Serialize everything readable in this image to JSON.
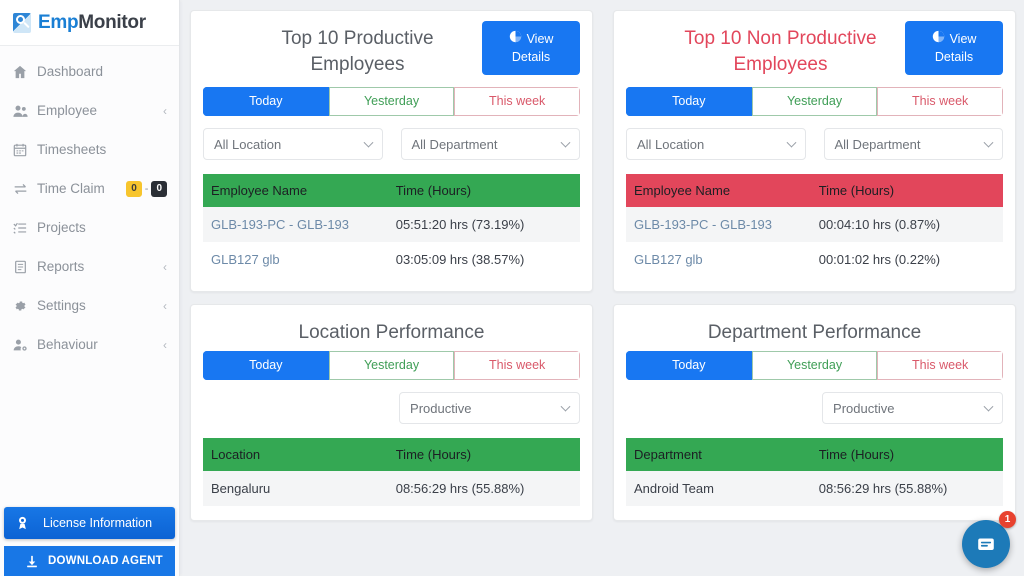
{
  "brand": {
    "part1": "Emp",
    "part2": "Monitor",
    "icon": "magnifier-logo-icon"
  },
  "sidebar": {
    "items": [
      {
        "label": "Dashboard",
        "icon": "home-icon",
        "chevron": "",
        "badges": []
      },
      {
        "label": "Employee",
        "icon": "users-icon",
        "chevron": "‹",
        "badges": []
      },
      {
        "label": "Timesheets",
        "icon": "calendar-icon",
        "chevron": "",
        "badges": []
      },
      {
        "label": "Time Claim",
        "icon": "exchange-icon",
        "chevron": "",
        "badges": [
          "0",
          "0"
        ],
        "badge_sep": "-"
      },
      {
        "label": "Projects",
        "icon": "list-icon",
        "chevron": "",
        "badges": []
      },
      {
        "label": "Reports",
        "icon": "document-icon",
        "chevron": "‹",
        "badges": []
      },
      {
        "label": "Settings",
        "icon": "gear-icon",
        "chevron": "‹",
        "badges": []
      },
      {
        "label": "Behaviour",
        "icon": "user-cog-icon",
        "chevron": "‹",
        "badges": []
      }
    ],
    "license_label": "License Information",
    "download_label": "DOWNLOAD AGENT"
  },
  "view_details": {
    "line1": "View",
    "line2": "Details",
    "icon": "pie-chart-icon"
  },
  "tabs": {
    "today": "Today",
    "yesterday": "Yesterday",
    "this_week": "This week"
  },
  "colors": {
    "primary_blue": "#1877f2",
    "green_header": "#34a853",
    "red_header": "#e2465b",
    "danger_title": "#e2465b",
    "badge_warn": "#f7c52d",
    "badge_dark": "#2b2f36",
    "chat_blue": "#1d7ab8",
    "chat_badge_red": "#e8422f"
  },
  "cards": {
    "productive": {
      "title": "Top 10 Productive Employees",
      "location_filter": "All Location",
      "department_filter": "All Department",
      "columns": [
        "Employee Name",
        "Time (Hours)"
      ],
      "rows": [
        {
          "name": "GLB-193-PC - GLB-193",
          "time": "05:51:20 hrs (73.19%)"
        },
        {
          "name": "GLB127 glb",
          "time": "03:05:09 hrs (38.57%)"
        }
      ]
    },
    "non_productive": {
      "title": "Top 10 Non Productive Employees",
      "location_filter": "All Location",
      "department_filter": "All Department",
      "columns": [
        "Employee Name",
        "Time (Hours)"
      ],
      "rows": [
        {
          "name": "GLB-193-PC - GLB-193",
          "time": "00:04:10 hrs (0.87%)"
        },
        {
          "name": "GLB127 glb",
          "time": "00:01:02 hrs (0.22%)"
        }
      ]
    },
    "location_performance": {
      "title": "Location Performance",
      "type_filter": "Productive",
      "columns": [
        "Location",
        "Time (Hours)"
      ],
      "rows": [
        {
          "name": "Bengaluru",
          "time": "08:56:29 hrs (55.88%)"
        }
      ]
    },
    "department_performance": {
      "title": "Department Performance",
      "type_filter": "Productive",
      "columns": [
        "Department",
        "Time (Hours)"
      ],
      "rows": [
        {
          "name": "Android Team",
          "time": "08:56:29 hrs (55.88%)"
        }
      ]
    }
  },
  "chat": {
    "badge_count": "1",
    "icon": "chat-message-icon"
  }
}
